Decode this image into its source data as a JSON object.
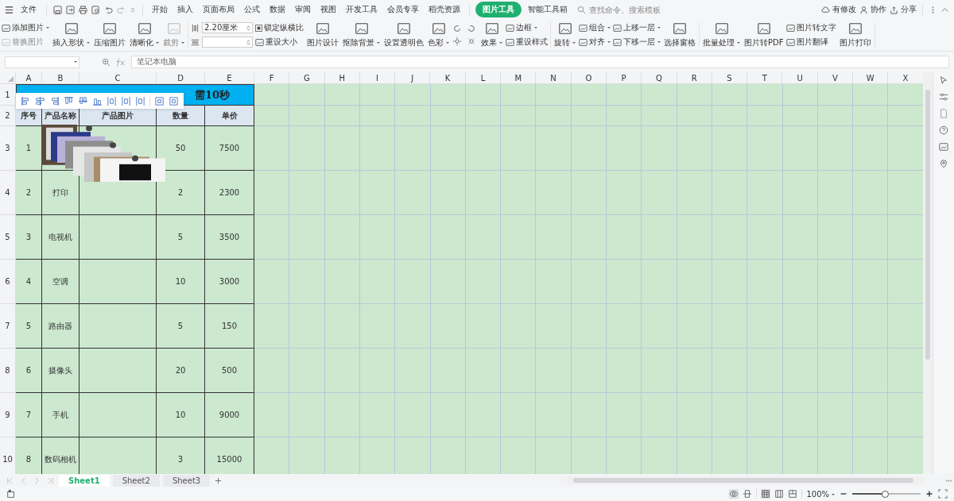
{
  "menu": {
    "file": "文件",
    "tabs": [
      {
        "label": "开始",
        "selected": false
      },
      {
        "label": "插入",
        "selected": false
      },
      {
        "label": "页面布局",
        "selected": false
      },
      {
        "label": "公式",
        "selected": false
      },
      {
        "label": "数据",
        "selected": false
      },
      {
        "label": "审阅",
        "selected": false
      },
      {
        "label": "视图",
        "selected": false
      },
      {
        "label": "开发工具",
        "selected": false
      },
      {
        "label": "会员专享",
        "selected": false
      },
      {
        "label": "稻壳资源",
        "selected": false
      },
      {
        "label": "图片工具",
        "selected": true
      },
      {
        "label": "智能工具箱",
        "selected": false
      }
    ],
    "search": {
      "placeholder": "查找命令、搜索模板"
    },
    "actions": [
      "有修改",
      "协作",
      "分享"
    ]
  },
  "ribbon": [
    {
      "kind": "stack",
      "items": [
        {
          "label": "添加图片",
          "dropdown": true,
          "disabled": false
        },
        {
          "label": "替换图片",
          "dropdown": false,
          "disabled": true
        }
      ]
    },
    {
      "kind": "big",
      "items": [
        {
          "label": "插入形状",
          "dropdown": true,
          "disabled": false
        }
      ]
    },
    {
      "kind": "big",
      "items": [
        {
          "label": "压缩图片",
          "dropdown": false,
          "disabled": false
        }
      ]
    },
    {
      "kind": "big",
      "items": [
        {
          "label": "清晰化",
          "dropdown": true,
          "disabled": false
        }
      ]
    },
    {
      "kind": "big",
      "items": [
        {
          "label": "裁剪",
          "dropdown": true,
          "disabled": true
        }
      ]
    },
    {
      "kind": "size",
      "items": [
        {
          "label": "2.20厘米"
        }
      ]
    },
    {
      "kind": "stack",
      "items": [
        {
          "label": "锁定纵横比",
          "dropdown": false,
          "disabled": false,
          "checked": true
        },
        {
          "label": "重设大小",
          "dropdown": false,
          "disabled": false
        }
      ]
    },
    {
      "kind": "big",
      "items": [
        {
          "label": "图片设计",
          "dropdown": false,
          "disabled": false
        }
      ]
    },
    {
      "kind": "big",
      "items": [
        {
          "label": "抠除背景",
          "dropdown": true,
          "disabled": false
        }
      ]
    },
    {
      "kind": "big",
      "items": [
        {
          "label": "设置透明色",
          "dropdown": false,
          "disabled": false
        }
      ]
    },
    {
      "kind": "big",
      "items": [
        {
          "label": "色彩",
          "dropdown": true,
          "disabled": false
        }
      ]
    },
    {
      "kind": "adjust"
    },
    {
      "kind": "big",
      "items": [
        {
          "label": "效果",
          "dropdown": true,
          "disabled": false
        }
      ]
    },
    {
      "kind": "stack",
      "items": [
        {
          "label": "边框",
          "dropdown": true,
          "disabled": false
        },
        {
          "label": "重设样式",
          "dropdown": false,
          "disabled": false
        }
      ]
    },
    {
      "kind": "big",
      "items": [
        {
          "label": "旋转",
          "dropdown": true,
          "disabled": false
        }
      ]
    },
    {
      "kind": "stack",
      "items": [
        {
          "label": "组合",
          "dropdown": true,
          "disabled": false
        },
        {
          "label": "对齐",
          "dropdown": true,
          "disabled": false
        }
      ]
    },
    {
      "kind": "stack",
      "items": [
        {
          "label": "上移一层",
          "dropdown": true,
          "disabled": false
        },
        {
          "label": "下移一层",
          "dropdown": true,
          "disabled": false
        }
      ]
    },
    {
      "kind": "big",
      "items": [
        {
          "label": "选择窗格",
          "dropdown": false,
          "disabled": false
        }
      ]
    },
    {
      "kind": "big",
      "items": [
        {
          "label": "批量处理",
          "dropdown": true,
          "disabled": false
        }
      ]
    },
    {
      "kind": "big",
      "items": [
        {
          "label": "图片转PDF",
          "dropdown": false,
          "disabled": false
        }
      ]
    },
    {
      "kind": "stack",
      "items": [
        {
          "label": "图片转文字",
          "dropdown": false,
          "disabled": false
        },
        {
          "label": "图片翻译",
          "dropdown": false,
          "disabled": false
        }
      ]
    },
    {
      "kind": "big",
      "items": [
        {
          "label": "图片打印",
          "dropdown": false,
          "disabled": false
        }
      ]
    }
  ],
  "formula_bar": {
    "formula": "笔记本电脑"
  },
  "columns": [
    "A",
    "B",
    "C",
    "D",
    "E",
    "F",
    "G",
    "H",
    "I",
    "J",
    "K",
    "L",
    "M",
    "N",
    "O",
    "P",
    "Q",
    "R",
    "S",
    "T",
    "U",
    "V",
    "W",
    "X"
  ],
  "row_numbers": [
    "1",
    "2",
    "3",
    "4",
    "5",
    "6",
    "7",
    "8",
    "9",
    "10"
  ],
  "table": {
    "title": "需10秒",
    "headers": [
      "序号",
      "产品名称",
      "产品图片",
      "数量",
      "单价"
    ],
    "rows": [
      {
        "no": "1",
        "qty": "50",
        "price": "7500"
      },
      {
        "no": "2",
        "name": "打印",
        "qty": "2",
        "price": "2300"
      },
      {
        "no": "3",
        "name": "电视机",
        "qty": "5",
        "price": "3500"
      },
      {
        "no": "4",
        "name": "空调",
        "qty": "10",
        "price": "3000"
      },
      {
        "no": "5",
        "name": "路由器",
        "qty": "5",
        "price": "150"
      },
      {
        "no": "6",
        "name": "摄像头",
        "qty": "20",
        "price": "500"
      },
      {
        "no": "7",
        "name": "手机",
        "qty": "10",
        "price": "9000"
      },
      {
        "no": "8",
        "name": "数码相机",
        "qty": "3",
        "price": "15000"
      }
    ]
  },
  "sheets": [
    {
      "label": "Sheet1",
      "selected": true
    },
    {
      "label": "Sheet2",
      "selected": false
    },
    {
      "label": "Sheet3",
      "selected": false
    }
  ],
  "status_bar": {
    "zoom": "100%",
    "zoom_slider": {
      "level": 0.48
    }
  }
}
